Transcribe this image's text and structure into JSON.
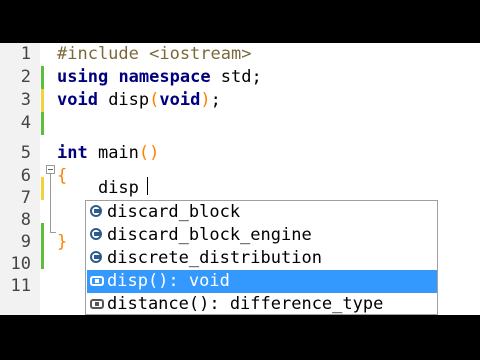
{
  "editor": {
    "line_numbers": [
      "1",
      "2",
      "3",
      "4",
      "5",
      "6",
      "7",
      "8",
      "9",
      "10",
      "11"
    ],
    "lines": [
      {
        "id": "l1",
        "parts": [
          {
            "t": "#include <iostream>",
            "c": "pp"
          }
        ]
      },
      {
        "id": "l2",
        "parts": [
          {
            "t": "using",
            "c": "k"
          },
          {
            "t": " ",
            "c": ""
          },
          {
            "t": "namespace",
            "c": "k"
          },
          {
            "t": " std;",
            "c": ""
          }
        ]
      },
      {
        "id": "l3",
        "parts": [
          {
            "t": "void",
            "c": "k"
          },
          {
            "t": " disp",
            "c": ""
          },
          {
            "t": "(",
            "c": "br"
          },
          {
            "t": "void",
            "c": "k"
          },
          {
            "t": ")",
            "c": "br"
          },
          {
            "t": ";",
            "c": ""
          }
        ]
      },
      {
        "id": "l4",
        "parts": []
      },
      {
        "id": "l5",
        "parts": [
          {
            "t": "int",
            "c": "k"
          },
          {
            "t": " main",
            "c": ""
          },
          {
            "t": "()",
            "c": "br"
          }
        ]
      },
      {
        "id": "l6",
        "parts": [
          {
            "t": "{",
            "c": "br"
          }
        ]
      },
      {
        "id": "l7",
        "parts": [
          {
            "t": "    disp",
            "c": ""
          }
        ]
      },
      {
        "id": "l8",
        "parts": []
      },
      {
        "id": "l9",
        "parts": [
          {
            "t": "}",
            "c": "br"
          }
        ]
      },
      {
        "id": "l10",
        "parts": []
      },
      {
        "id": "l11",
        "parts": []
      }
    ],
    "change_markers": {
      "green": [
        "2",
        "3",
        "5",
        "9",
        "10"
      ],
      "yellow": [
        "7"
      ]
    }
  },
  "autocomplete": {
    "items": [
      {
        "icon": "class-icon",
        "label": "discard_block",
        "selected": false
      },
      {
        "icon": "class-icon",
        "label": "discard_block_engine",
        "selected": false
      },
      {
        "icon": "class-icon",
        "label": "discrete_distribution",
        "selected": false
      },
      {
        "icon": "function-icon",
        "label": "disp(): void",
        "selected": true
      },
      {
        "icon": "function-icon",
        "label": "distance(): difference_type",
        "selected": false
      }
    ],
    "colors": {
      "selection": "#3399ff"
    }
  }
}
